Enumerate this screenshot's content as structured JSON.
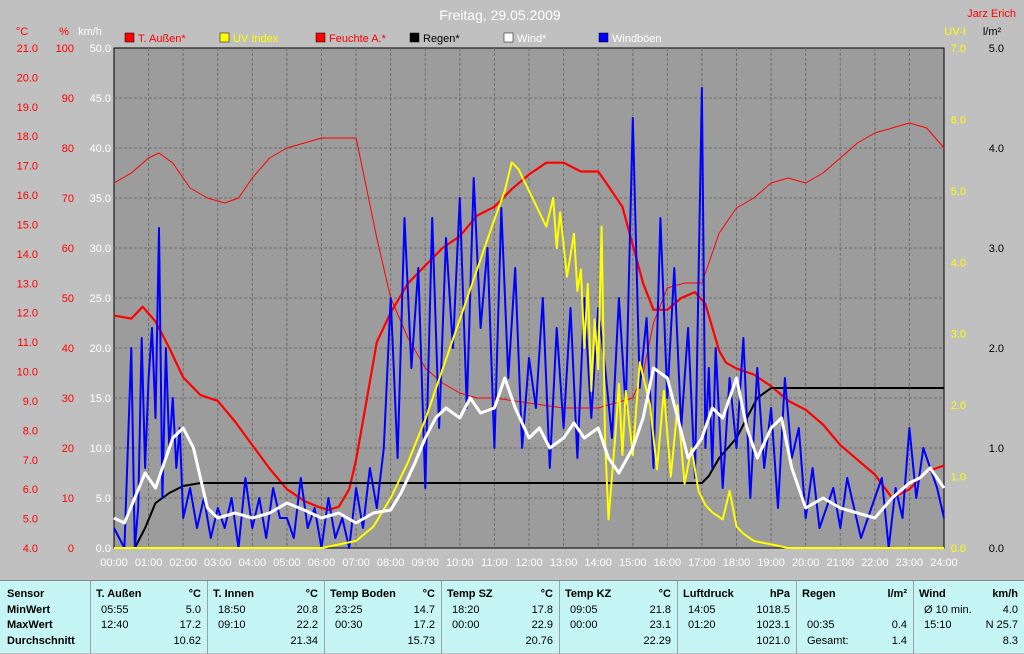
{
  "chart_data": {
    "type": "line",
    "title": "Freitag, 29.05.2009",
    "author": "Jarz Erich",
    "x_ticks": [
      "00:00",
      "01:00",
      "02:00",
      "03:00",
      "04:00",
      "05:00",
      "06:00",
      "07:00",
      "08:00",
      "09:00",
      "10:00",
      "11:00",
      "12:00",
      "13:00",
      "14:00",
      "15:00",
      "16:00",
      "17:00",
      "18:00",
      "19:00",
      "20:00",
      "21:00",
      "22:00",
      "23:00",
      "24:00"
    ],
    "axes": {
      "temp_c": {
        "unit": "°C",
        "range": [
          4.0,
          21.0
        ],
        "ticks": [
          "4.0",
          "5.0",
          "6.0",
          "7.0",
          "8.0",
          "9.0",
          "10.0",
          "11.0",
          "12.0",
          "13.0",
          "14.0",
          "15.0",
          "16.0",
          "17.0",
          "18.0",
          "19.0",
          "20.0",
          "21.0"
        ]
      },
      "humidity": {
        "unit": "%",
        "range": [
          0,
          100
        ],
        "ticks": [
          "0",
          "10",
          "20",
          "30",
          "40",
          "50",
          "60",
          "70",
          "80",
          "90",
          "100"
        ]
      },
      "wind_kmh": {
        "unit": "km/h",
        "range": [
          0,
          50
        ],
        "ticks": [
          "0.0",
          "5.0",
          "10.0",
          "15.0",
          "20.0",
          "25.0",
          "30.0",
          "35.0",
          "40.0",
          "45.0",
          "50.0"
        ]
      },
      "uv": {
        "unit": "UV-I",
        "range": [
          0,
          7
        ],
        "ticks": [
          "0.0",
          "1.0",
          "2.0",
          "3.0",
          "4.0",
          "5.0",
          "6.0",
          "7.0"
        ]
      },
      "rain": {
        "unit": "l/m²",
        "range": [
          0,
          5
        ],
        "ticks": [
          "0.0",
          "1.0",
          "2.0",
          "3.0",
          "4.0",
          "5.0"
        ]
      }
    },
    "legend": [
      {
        "name": "T. Außen*",
        "color": "#ff0000",
        "text_color": "#ff0000"
      },
      {
        "name": "UV Index",
        "color": "#ffff00",
        "text_color": "#ffff00"
      },
      {
        "name": "Feuchte A.*",
        "color": "#ff0000",
        "text_color": "#ff0000"
      },
      {
        "name": "Regen*",
        "color": "#000000",
        "text_color": "#000000"
      },
      {
        "name": "Wind*",
        "color": "#ffffff",
        "text_color": "#ffffff"
      },
      {
        "name": "Windböen",
        "color": "#0000ff",
        "text_color": "#ffffff"
      }
    ],
    "series": [
      {
        "name": "T. Außen*",
        "axis": "temp_c",
        "color": "#ff0000",
        "x": [
          0,
          0.5,
          0.83,
          1.2,
          1.6,
          2.0,
          2.5,
          3.0,
          3.5,
          4.0,
          4.5,
          5.0,
          5.5,
          5.9,
          6.2,
          6.5,
          6.8,
          7.0,
          7.3,
          7.6,
          8.0,
          8.5,
          9.0,
          9.5,
          10.0,
          10.5,
          11.0,
          11.5,
          12.0,
          12.5,
          13.0,
          13.5,
          14.0,
          14.3,
          14.7,
          15.0,
          15.3,
          15.6,
          16.0,
          16.4,
          16.8,
          17.1,
          17.3,
          17.5,
          17.7,
          18.0,
          18.5,
          19.0,
          19.5,
          20.0,
          20.5,
          21.0,
          21.5,
          22.0,
          22.5,
          23.0,
          23.5,
          24.0
        ],
        "y": [
          11.9,
          11.8,
          12.2,
          11.7,
          10.8,
          9.8,
          9.2,
          9.0,
          8.3,
          7.5,
          6.7,
          6.0,
          5.6,
          5.4,
          5.3,
          5.4,
          6.0,
          7.0,
          9.0,
          11.0,
          12.0,
          13.0,
          13.6,
          14.2,
          14.6,
          15.3,
          15.6,
          16.2,
          16.7,
          17.1,
          17.1,
          16.8,
          16.8,
          16.3,
          15.6,
          14.3,
          13.0,
          12.1,
          12.1,
          12.5,
          12.7,
          12.3,
          11.5,
          10.7,
          10.3,
          10.1,
          9.9,
          9.5,
          9.0,
          8.7,
          8.2,
          7.5,
          7.0,
          6.5,
          5.7,
          6.0,
          6.6,
          6.8
        ]
      },
      {
        "name": "Feuchte A.*",
        "axis": "humidity",
        "color": "#ff0000",
        "x": [
          0,
          0.5,
          1.0,
          1.3,
          1.7,
          2.2,
          2.7,
          3.2,
          3.6,
          4.0,
          4.5,
          5.0,
          5.5,
          6.0,
          6.5,
          7.0,
          7.3,
          7.6,
          8.0,
          8.5,
          9.0,
          9.5,
          10.0,
          10.5,
          11.0,
          12.0,
          13.0,
          14.0,
          14.5,
          15.0,
          15.3,
          15.6,
          16.0,
          16.5,
          17.0,
          17.2,
          17.5,
          18.0,
          18.5,
          19.0,
          19.5,
          20.0,
          20.5,
          21.0,
          21.5,
          22.0,
          22.5,
          23.0,
          23.5,
          24.0
        ],
        "y": [
          73,
          75,
          78,
          79,
          77,
          72,
          70,
          69,
          70,
          74,
          78,
          80,
          81,
          82,
          82,
          82,
          72,
          62,
          50,
          42,
          36,
          33,
          31,
          30,
          30,
          29,
          28,
          28,
          29,
          30,
          35,
          45,
          52,
          53,
          53,
          57,
          63,
          68,
          70,
          73,
          74,
          73,
          75,
          78,
          81,
          83,
          84,
          85,
          84,
          80
        ]
      },
      {
        "name": "UV Index",
        "axis": "uv",
        "color": "#ffff00",
        "x": [
          0,
          6.0,
          7.0,
          7.5,
          8.0,
          8.5,
          9.0,
          9.5,
          10.0,
          10.5,
          11.0,
          11.3,
          11.5,
          11.7,
          12.0,
          12.2,
          12.5,
          12.7,
          12.8,
          12.9,
          13.1,
          13.3,
          13.4,
          13.5,
          13.6,
          13.7,
          13.8,
          13.9,
          14.0,
          14.1,
          14.2,
          14.3,
          14.5,
          14.6,
          14.7,
          14.8,
          15.0,
          15.2,
          15.5,
          15.7,
          15.9,
          16.1,
          16.3,
          16.5,
          16.7,
          16.9,
          17.1,
          17.3,
          17.6,
          17.8,
          18.0,
          18.2,
          18.5,
          19.0,
          19.5,
          20.0,
          24.0
        ],
        "y": [
          0,
          0,
          0.1,
          0.3,
          0.7,
          1.2,
          1.8,
          2.5,
          3.2,
          3.9,
          4.6,
          5.0,
          5.4,
          5.3,
          5.0,
          4.8,
          4.5,
          4.9,
          4.2,
          4.7,
          3.8,
          4.4,
          3.6,
          3.9,
          2.8,
          3.7,
          2.2,
          3.2,
          2.5,
          4.5,
          1.5,
          0.4,
          1.6,
          2.3,
          1.3,
          2.2,
          1.3,
          2.6,
          2.0,
          1.1,
          2.2,
          1.0,
          2.0,
          0.9,
          1.4,
          0.8,
          0.6,
          0.5,
          0.4,
          0.8,
          0.3,
          0.2,
          0.1,
          0.05,
          0,
          0,
          0
        ]
      },
      {
        "name": "Regen*",
        "axis": "rain",
        "color": "#000000",
        "x": [
          0,
          0.6,
          0.9,
          1.2,
          1.6,
          2.0,
          2.5,
          3.0,
          17.0,
          17.2,
          17.5,
          18.0,
          18.3,
          18.6,
          19.0,
          19.5,
          20.0,
          24.0
        ],
        "y": [
          0,
          0,
          0.2,
          0.45,
          0.55,
          0.62,
          0.65,
          0.65,
          0.65,
          0.72,
          0.9,
          1.1,
          1.3,
          1.5,
          1.6,
          1.6,
          1.6,
          1.6
        ]
      },
      {
        "name": "Wind*",
        "axis": "wind_kmh",
        "color": "#ffffff",
        "x": [
          0,
          0.3,
          0.6,
          0.9,
          1.2,
          1.5,
          1.7,
          2.0,
          2.3,
          2.7,
          3.0,
          3.5,
          4.0,
          4.5,
          5.0,
          5.5,
          6.0,
          6.5,
          7.0,
          7.5,
          8.0,
          8.3,
          8.7,
          9.0,
          9.3,
          9.6,
          10.0,
          10.3,
          10.6,
          11.0,
          11.3,
          11.6,
          12.0,
          12.3,
          12.6,
          13.0,
          13.3,
          13.6,
          14.0,
          14.3,
          14.6,
          15.0,
          15.3,
          15.6,
          16.0,
          16.3,
          16.6,
          17.0,
          17.3,
          17.6,
          18.0,
          18.3,
          18.6,
          19.0,
          19.3,
          19.6,
          20.0,
          20.5,
          21.0,
          21.5,
          22.0,
          22.5,
          23.0,
          23.3,
          23.6,
          24.0
        ],
        "y": [
          3,
          2.5,
          5,
          7.5,
          6,
          9,
          11,
          12,
          10,
          4,
          3,
          3.5,
          3,
          3.5,
          4.5,
          3.8,
          3,
          3.5,
          2.5,
          3.5,
          3.8,
          5.5,
          8.5,
          11,
          13,
          14,
          13,
          15,
          13.5,
          14,
          17,
          14,
          11,
          12,
          10,
          11,
          12.5,
          11,
          12,
          9,
          7.5,
          10,
          13,
          18,
          17,
          13,
          9,
          11,
          14,
          13,
          17,
          12,
          9,
          12,
          13,
          8,
          4,
          5,
          4,
          3.5,
          3,
          5,
          6.5,
          7,
          8,
          6
        ]
      },
      {
        "name": "Windböen",
        "axis": "wind_kmh",
        "color": "#0000ff",
        "x": [
          0,
          0.3,
          0.5,
          0.6,
          0.7,
          0.8,
          0.9,
          1.0,
          1.1,
          1.2,
          1.3,
          1.4,
          1.5,
          1.6,
          1.7,
          1.8,
          1.9,
          2.0,
          2.2,
          2.4,
          2.6,
          2.8,
          3.0,
          3.2,
          3.4,
          3.6,
          3.8,
          4.0,
          4.2,
          4.4,
          4.6,
          4.8,
          5.0,
          5.2,
          5.4,
          5.6,
          5.8,
          6.0,
          6.2,
          6.4,
          6.6,
          6.8,
          7.0,
          7.2,
          7.4,
          7.6,
          7.8,
          8.0,
          8.2,
          8.4,
          8.6,
          8.8,
          9.0,
          9.2,
          9.4,
          9.6,
          9.8,
          10.0,
          10.2,
          10.4,
          10.6,
          10.8,
          11.0,
          11.2,
          11.4,
          11.6,
          11.8,
          12.0,
          12.2,
          12.4,
          12.6,
          12.8,
          13.0,
          13.2,
          13.4,
          13.6,
          13.8,
          14.0,
          14.2,
          14.4,
          14.6,
          14.8,
          15.0,
          15.2,
          15.4,
          15.6,
          15.8,
          16.0,
          16.2,
          16.4,
          16.6,
          16.8,
          17.0,
          17.1,
          17.2,
          17.3,
          17.4,
          17.6,
          17.8,
          18.0,
          18.2,
          18.4,
          18.6,
          18.8,
          19.0,
          19.2,
          19.4,
          19.6,
          19.8,
          20.0,
          20.2,
          20.4,
          20.6,
          20.8,
          21.0,
          21.2,
          21.4,
          21.6,
          21.8,
          22.0,
          22.2,
          22.4,
          22.6,
          22.8,
          23.0,
          23.2,
          23.4,
          23.6,
          23.8,
          24.0
        ],
        "y": [
          2,
          0,
          20,
          0,
          4,
          21,
          8,
          17,
          22,
          13,
          32,
          5,
          20,
          10,
          15,
          8,
          12,
          3,
          6,
          2,
          5,
          1,
          4,
          2,
          5,
          0,
          7,
          2,
          5,
          1,
          6,
          3,
          3,
          1,
          7,
          2,
          4,
          0,
          5,
          1,
          3,
          0,
          6,
          2,
          8,
          4,
          10,
          25,
          9,
          33,
          18,
          28,
          6,
          33,
          12,
          31,
          20,
          35,
          14,
          37,
          22,
          30,
          10,
          34,
          17,
          28,
          10,
          19,
          14,
          25,
          8,
          22,
          12,
          24,
          9,
          25,
          13,
          24,
          18,
          11,
          25,
          14,
          43,
          16,
          23,
          8,
          33,
          15,
          28,
          12,
          22,
          7,
          46,
          10,
          18,
          8,
          20,
          6,
          17,
          10,
          21,
          5,
          18,
          8,
          14,
          4,
          17,
          9,
          12,
          3,
          8,
          2,
          4,
          6,
          2,
          7,
          4,
          1,
          3,
          5,
          7,
          0,
          6,
          3,
          12,
          5,
          10,
          8,
          6,
          3
        ]
      }
    ]
  },
  "table": {
    "row_labels": [
      "Sensor",
      "MinWert",
      "MaxWert",
      "Durchschnitt"
    ],
    "columns": [
      {
        "name": "T. Außen",
        "unit": "°C",
        "min_time": "05:55",
        "min": "5.0",
        "max_time": "12:40",
        "max": "17.2",
        "avg": "10.62"
      },
      {
        "name": "T. Innen",
        "unit": "°C",
        "min_time": "18:50",
        "min": "20.8",
        "max_time": "09:10",
        "max": "22.2",
        "avg": "21.34"
      },
      {
        "name": "Temp Boden",
        "unit": "°C",
        "min_time": "23:25",
        "min": "14.7",
        "max_time": "00:30",
        "max": "17.2",
        "avg": "15.73"
      },
      {
        "name": "Temp SZ",
        "unit": "°C",
        "min_time": "18:20",
        "min": "17.8",
        "max_time": "00:00",
        "max": "22.9",
        "avg": "20.76"
      },
      {
        "name": "Temp KZ",
        "unit": "°C",
        "min_time": "09:05",
        "min": "21.8",
        "max_time": "00:00",
        "max": "23.1",
        "avg": "22.29"
      },
      {
        "name": "Luftdruck",
        "unit": "hPa",
        "min_time": "14:05",
        "min": "1018.5",
        "max_time": "01:20",
        "max": "1023.1",
        "avg": "1021.0"
      },
      {
        "name": "Regen",
        "unit": "l/m²",
        "min_time": "",
        "min": "",
        "max_time": "00:35",
        "max": "0.4",
        "avg_label": "Gesamt:",
        "avg": "1.4"
      },
      {
        "name": "Wind",
        "unit": "km/h",
        "min_time": "Ø 10 min.",
        "min": "4.0",
        "max_time": "15:10",
        "max": "N 25.7",
        "avg": "8.3"
      }
    ]
  }
}
